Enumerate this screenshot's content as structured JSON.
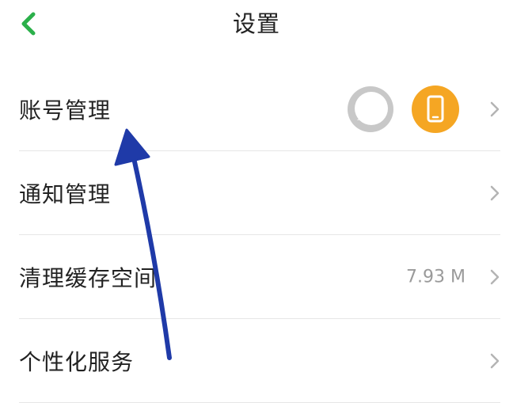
{
  "header": {
    "title": "设置",
    "back_icon": "chevron-left-icon"
  },
  "settings": {
    "items": [
      {
        "label": "账号管理",
        "icons": [
          "chat-bubble-icon",
          "phone-icon"
        ]
      },
      {
        "label": "通知管理"
      },
      {
        "label": "清理缓存空间",
        "value": "7.93 M"
      },
      {
        "label": "个性化服务"
      }
    ]
  },
  "colors": {
    "accent_green": "#2bb04a",
    "phone_orange": "#f5a623",
    "chat_gray": "#c8c8c8",
    "annotation_blue": "#1f3aa8"
  }
}
